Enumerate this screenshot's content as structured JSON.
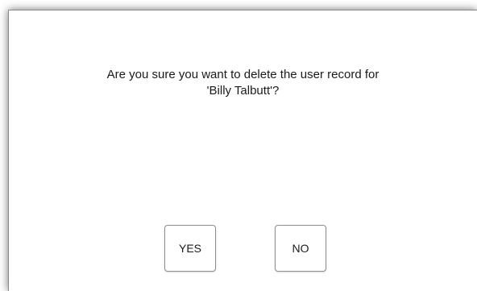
{
  "dialog": {
    "message_line1": "Are you sure you want to delete the user record for",
    "message_line2": "'Billy Talbutt'?",
    "yes_label": "YES",
    "no_label": "NO"
  }
}
